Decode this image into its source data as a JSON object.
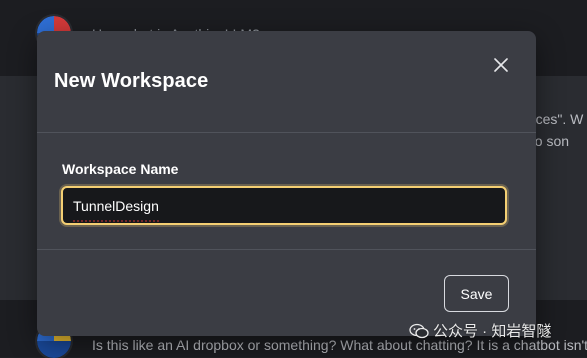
{
  "background": {
    "chat_top_text": "Hey, what is AnythingLLM?",
    "chat_mid_line1": "paces\". W",
    "chat_mid_line2": "into son",
    "chat_bottom_text": "Is this like an AI dropbox or something? What about chatting? It is a chatbot isn't it?"
  },
  "modal": {
    "title": "New Workspace",
    "field_label": "Workspace Name",
    "input_value": "TunnelDesign",
    "save_label": "Save",
    "accent_color": "#f4cf73"
  },
  "watermark": {
    "text": "公众号 · 知岩智隧",
    "icon": "wechat-icon"
  },
  "icons": {
    "close": "close-icon",
    "avatar": "avatar-icon"
  }
}
